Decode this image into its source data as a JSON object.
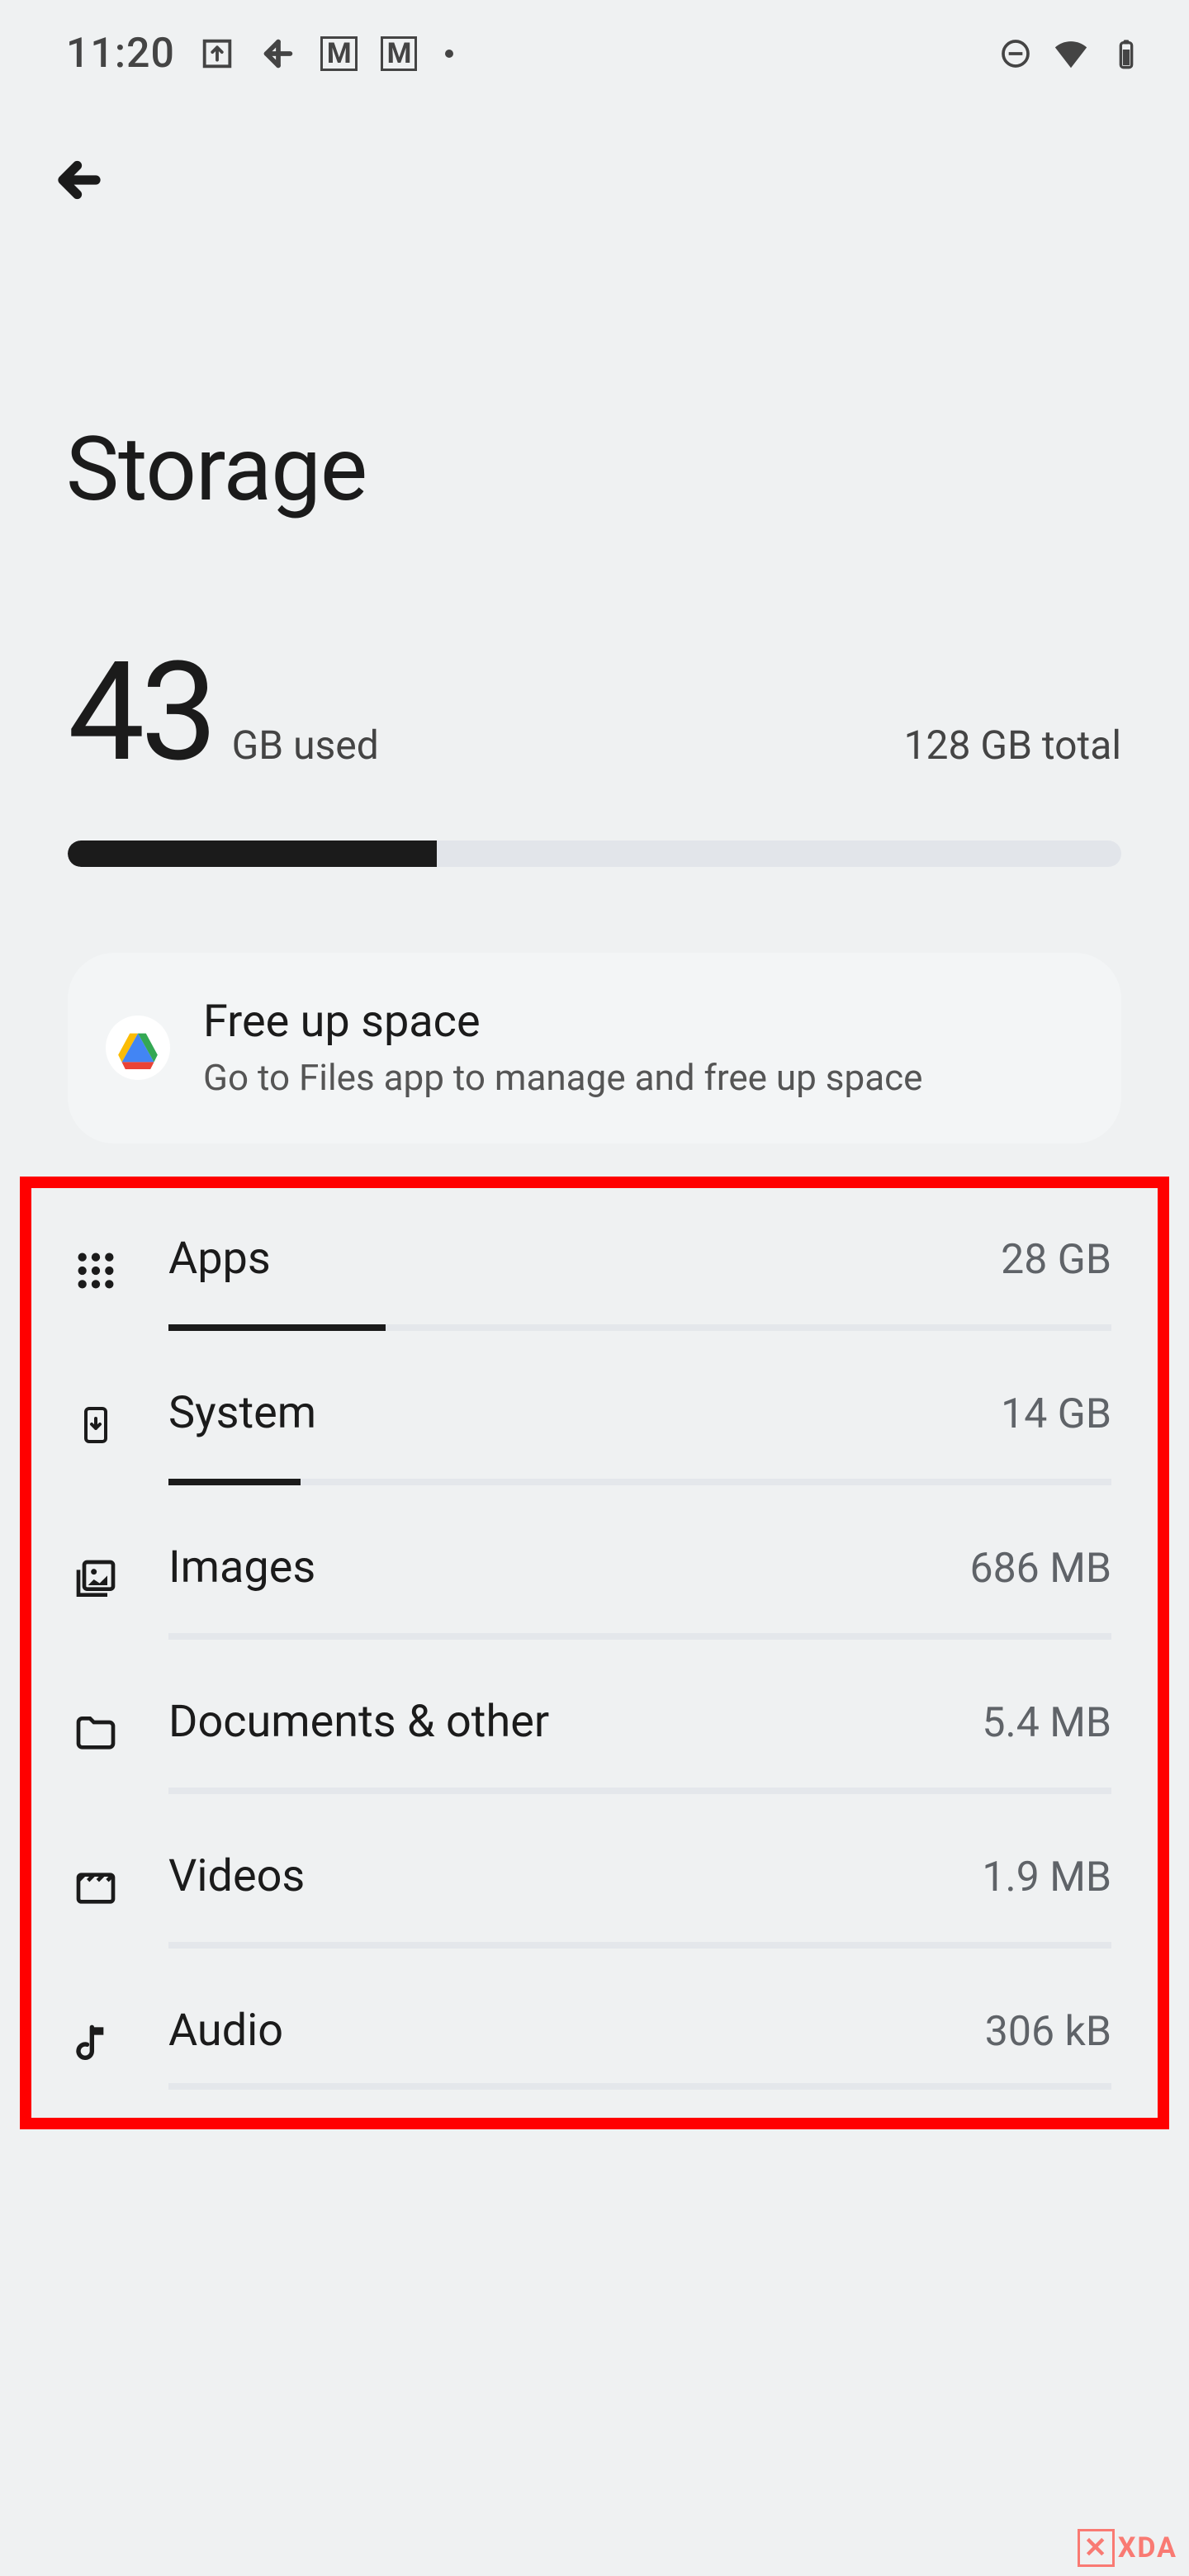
{
  "status": {
    "time": "11:20",
    "left_icons": [
      "share-icon",
      "slack-icon",
      "gmail-icon",
      "gmail-icon",
      "dot"
    ],
    "right_icons": [
      "do-not-disturb-icon",
      "wifi-icon",
      "battery-icon"
    ]
  },
  "page": {
    "title": "Storage"
  },
  "summary": {
    "used_value": "43",
    "used_suffix": "GB used",
    "total": "128 GB total",
    "fill_pct": 35
  },
  "free_up": {
    "title": "Free up space",
    "subtitle": "Go to Files app to manage and free up space"
  },
  "categories": [
    {
      "icon": "apps-icon",
      "name": "Apps",
      "size": "28 GB",
      "fill_pct": 23
    },
    {
      "icon": "system-icon",
      "name": "System",
      "size": "14 GB",
      "fill_pct": 14
    },
    {
      "icon": "images-icon",
      "name": "Images",
      "size": "686 MB",
      "fill_pct": 0
    },
    {
      "icon": "folder-icon",
      "name": "Documents & other",
      "size": "5.4 MB",
      "fill_pct": 0
    },
    {
      "icon": "videos-icon",
      "name": "Videos",
      "size": "1.9 MB",
      "fill_pct": 0
    },
    {
      "icon": "audio-icon",
      "name": "Audio",
      "size": "306 kB",
      "fill_pct": 0
    }
  ],
  "watermark": "XDA"
}
